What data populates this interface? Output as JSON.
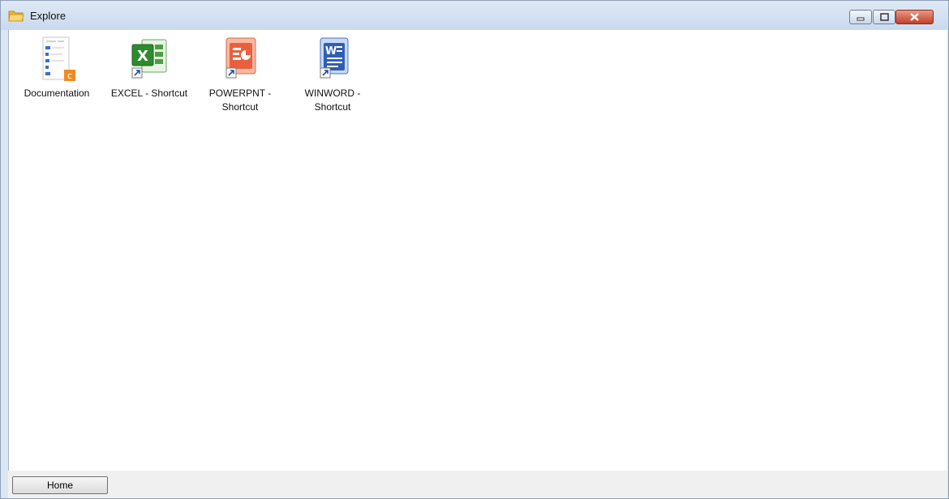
{
  "window": {
    "title": "Explore",
    "title_icon": "folder-icon",
    "controls": [
      "minimize",
      "maximize",
      "close"
    ]
  },
  "items": [
    {
      "label": "Documentation",
      "icon": "document-icon",
      "badge": "orange-c"
    },
    {
      "label": "EXCEL - Shortcut",
      "icon": "excel-icon",
      "shortcut": true
    },
    {
      "label": "POWERPNT - Shortcut",
      "icon": "powerpoint-icon",
      "shortcut": true
    },
    {
      "label": "WINWORD - Shortcut",
      "icon": "word-icon",
      "shortcut": true
    }
  ],
  "statusbar": {
    "home_label": "Home"
  },
  "colors": {
    "titlebar": "#c9d9ee",
    "close_button": "#c2402a",
    "excel": "#3a9a3a",
    "powerpoint": "#e2563a",
    "word": "#2f5fb5",
    "doc_badge": "#f08a24"
  }
}
